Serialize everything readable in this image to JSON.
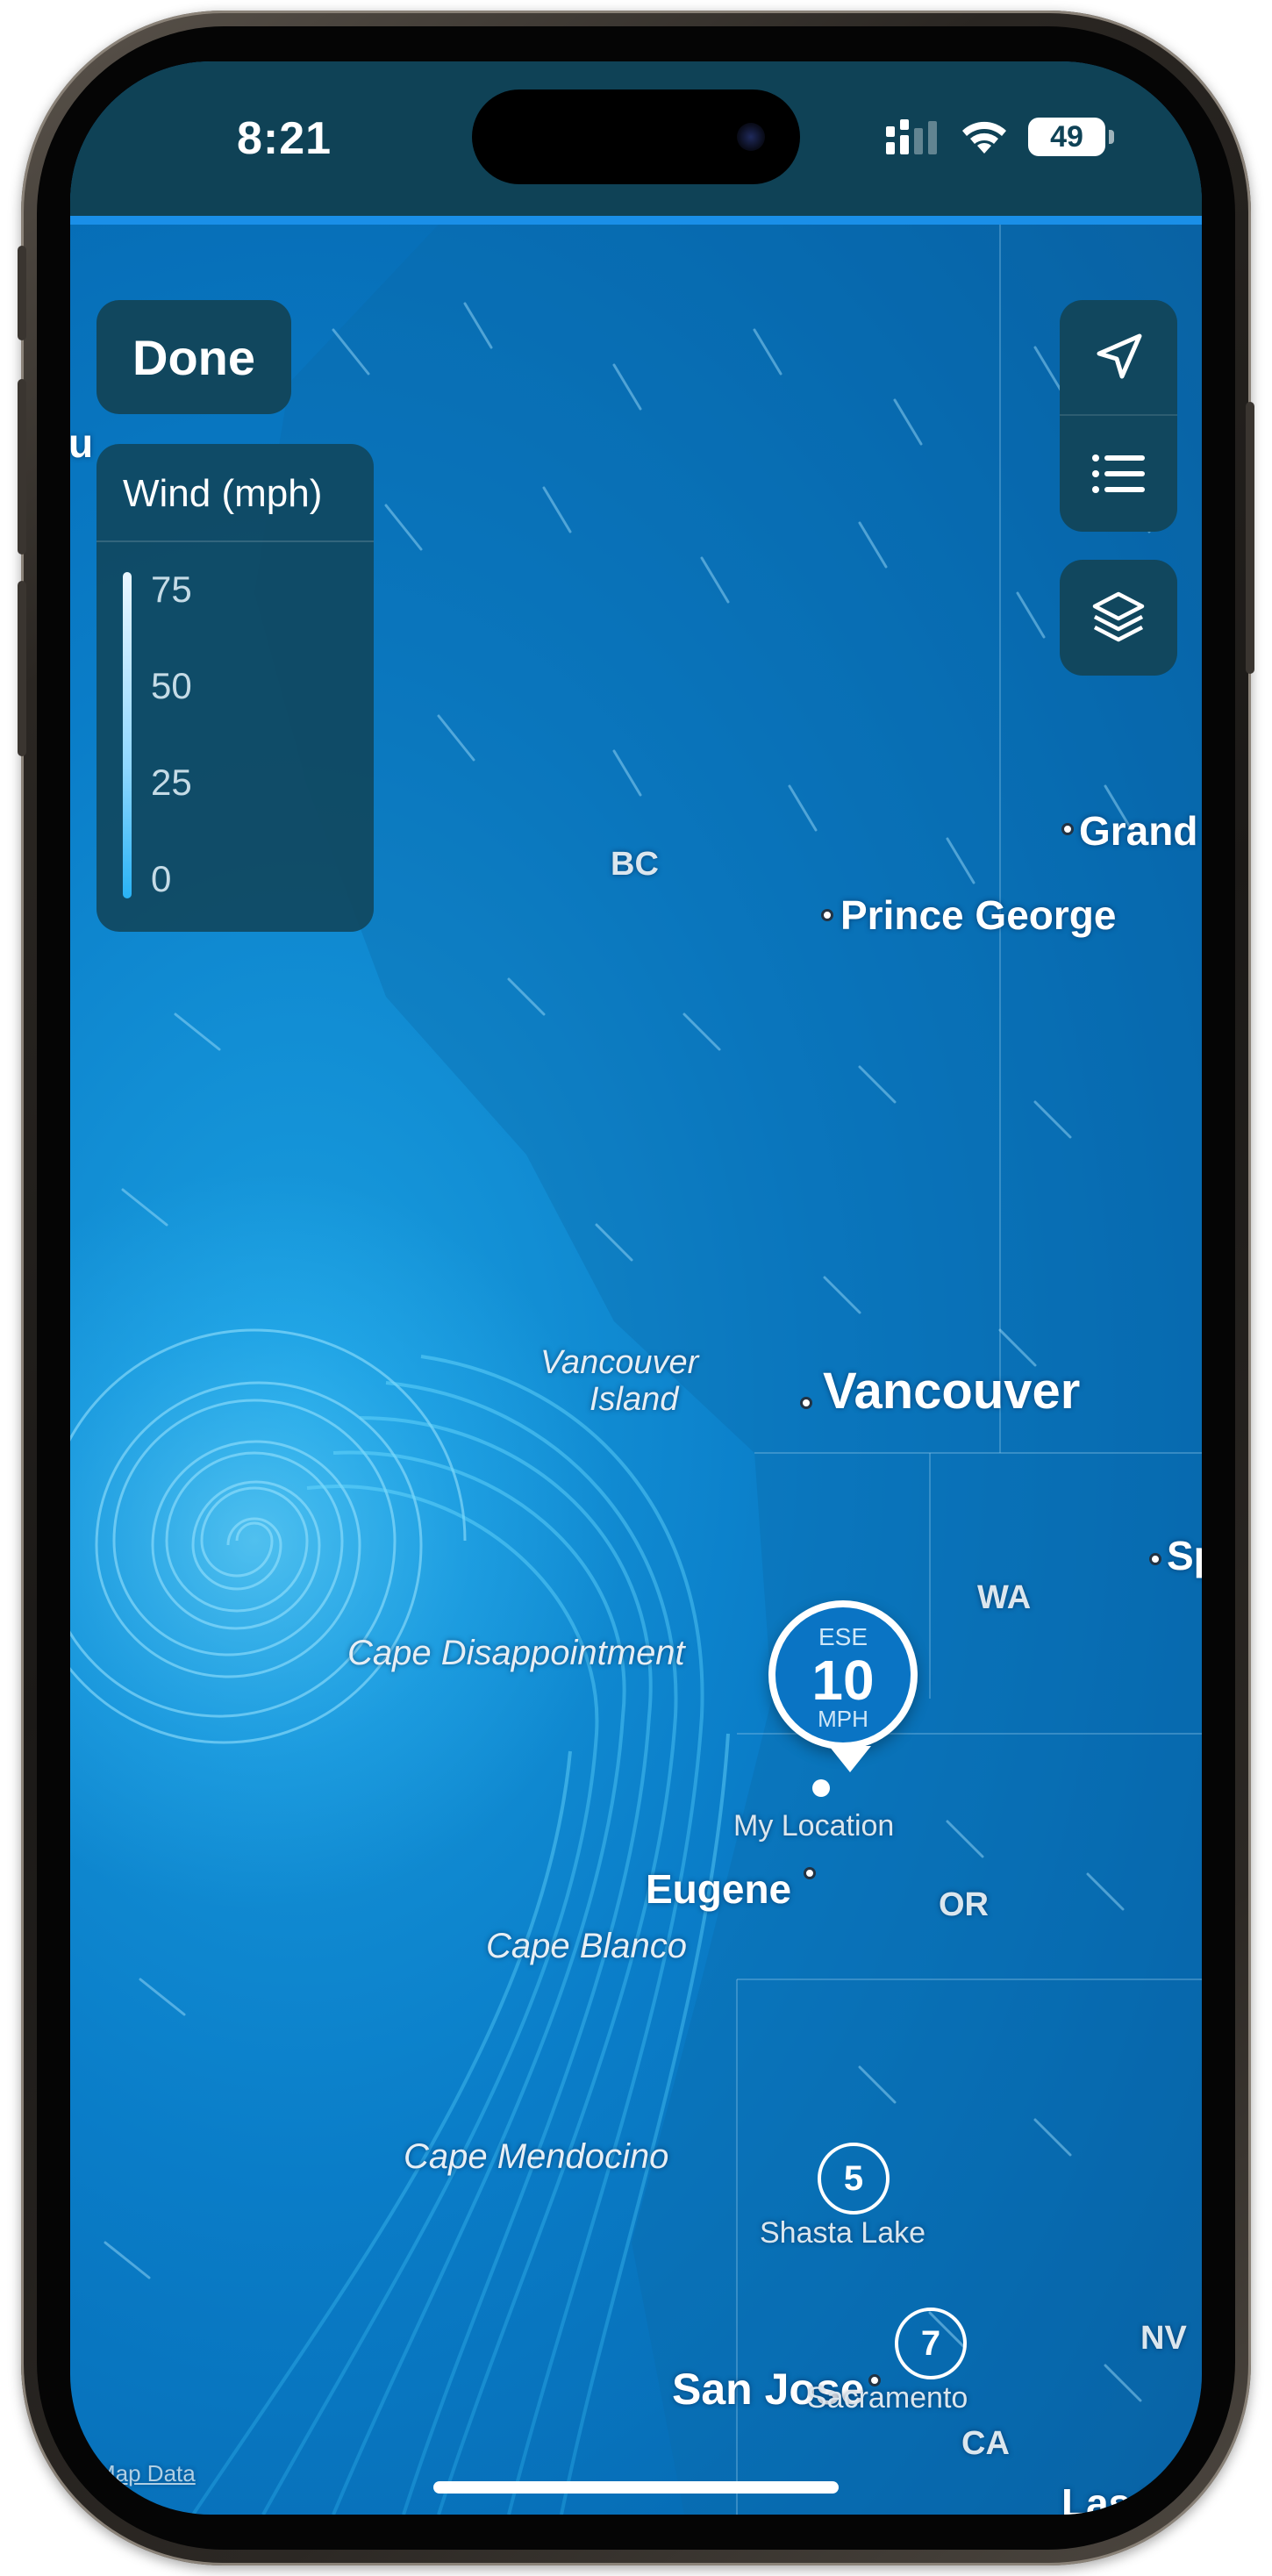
{
  "status": {
    "time": "8:21",
    "battery": "49"
  },
  "controls": {
    "done_label": "Done"
  },
  "legend": {
    "title": "Wind (mph)",
    "values": [
      "75",
      "50",
      "25",
      "0"
    ]
  },
  "map": {
    "regions": {
      "bc": "BC",
      "wa": "WA",
      "or": "OR",
      "ca": "CA",
      "nv": "NV"
    },
    "cities": {
      "grand": "Grand",
      "prince_george": "Prince George",
      "vancouver": "Vancouver",
      "spokane_partial": "Sp",
      "eugene": "Eugene",
      "san_jose": "San Jose",
      "las_vegas_partial": "Las V",
      "left_partial": "u"
    },
    "features": {
      "vancouver_island_line1": "Vancouver",
      "vancouver_island_line2": "Island",
      "cape_disappointment": "Cape Disappointment",
      "cape_blanco": "Cape Blanco",
      "cape_mendocino": "Cape Mendocino"
    },
    "attribution": "Map Data"
  },
  "current_location": {
    "direction": "ESE",
    "speed": "10",
    "unit": "MPH",
    "label": "My Location"
  },
  "wind_badges": {
    "shasta_lake": {
      "value": "5",
      "label": "Shasta Lake"
    },
    "sacramento": {
      "value": "7",
      "label": "Sacramento"
    }
  },
  "colors": {
    "map_blue": "#0a7dc8",
    "control_bg": "#11475e",
    "pin_blue": "#0a74c4"
  }
}
